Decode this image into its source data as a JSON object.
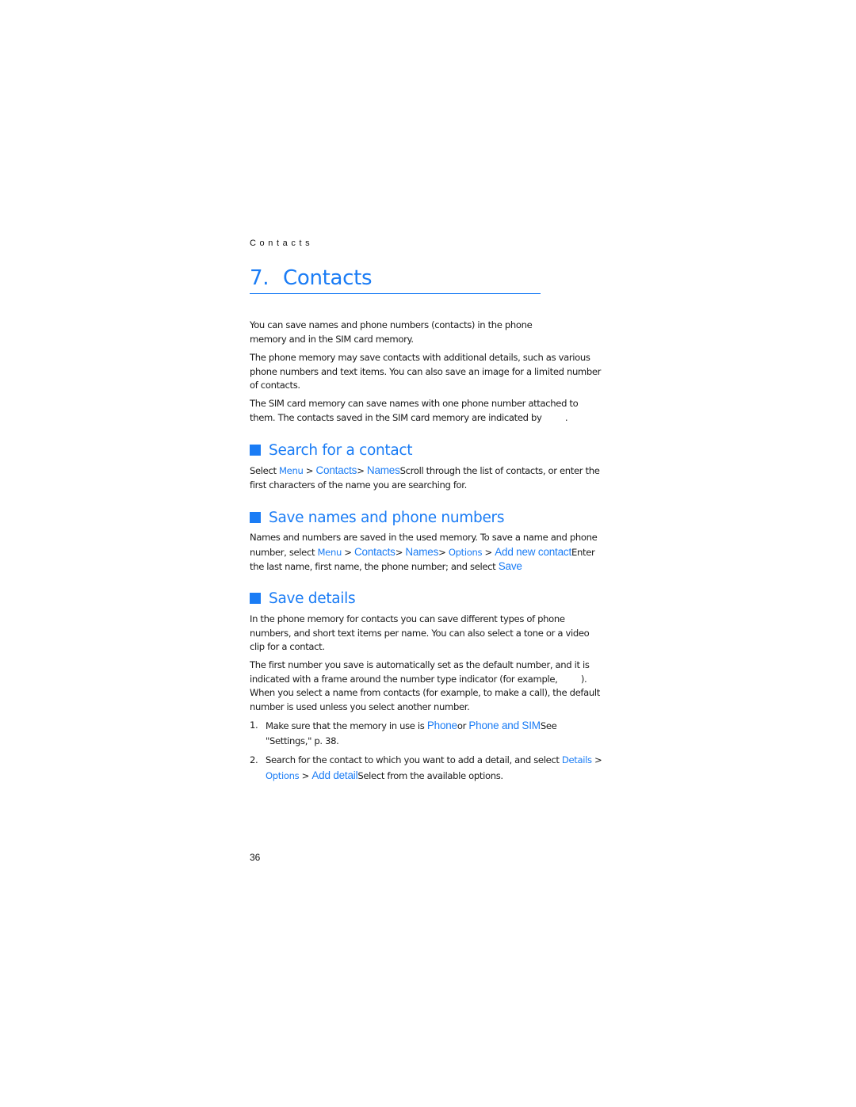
{
  "running_head": "Contacts",
  "chapter": {
    "number": "7.",
    "title": "Contacts"
  },
  "intro": {
    "p1": "You can save names and phone numbers (contacts) in the phone memory and in the SIM card memory.",
    "p1_line1": "You can save names and phone numbers (contacts) in the phone",
    "p1_line2": "memory and in the SIM card memory.",
    "p2": "The phone memory may save contacts with additional details, such as various phone numbers and text items. You can also save an image for a limited number of contacts.",
    "p3_a": "The SIM card memory can save names with one phone number attached to them. The contacts saved in the SIM card memory are indicated by",
    "p3_icon": "sim-contact-icon",
    "p3_b": "."
  },
  "sections": {
    "search": {
      "title": "Search for a contact",
      "t1": "Select ",
      "menu": "Menu",
      "sep1": " > ",
      "contacts": "Contacts",
      "sep2": "> ",
      "names": "Names",
      "t2": "Scroll through the list of contacts, or enter the first characters of the name you are searching for."
    },
    "save_names": {
      "title": "Save names and phone numbers",
      "t1": "Names and numbers are saved in the used memory. To save a name and phone number, select ",
      "menu": "Menu",
      "sep1": " > ",
      "contacts": "Contacts",
      "sep2": "> ",
      "names": "Names",
      "sep3": "> ",
      "options": "Options",
      "sep4": " > ",
      "add_new": "Add new contact",
      "t2": "Enter the last name, first name, the phone number; and select ",
      "save": "Save"
    },
    "save_details": {
      "title": "Save details",
      "p1": "In the phone memory for contacts you can save different types of phone numbers, and short text items per name. You can also select a tone or a video clip for a contact.",
      "p2_a": "The first number you save is automatically set as the default number, and it is indicated with a frame around the number type indicator (for example,",
      "p2_icon": "default-number-indicator-icon",
      "p2_b": "). When you select a name from contacts (for example, to make a call), the default number is used unless you select another number.",
      "steps": [
        {
          "n": "1.",
          "t1": "Make sure that the memory in use is ",
          "k1": "Phone",
          "t2": "or ",
          "k2": "Phone and SIM",
          "t3": "See \"Settings,\" p. 38."
        },
        {
          "n": "2.",
          "t1": "Search for the contact to which you want to add a detail, and select ",
          "k1": "Details",
          "t2": " > ",
          "k2": "Options",
          "t3": " > ",
          "k3": "Add detail",
          "t4": "Select from the available options."
        }
      ]
    }
  },
  "page_number": "36",
  "colors": {
    "accent": "#1a7cf5",
    "text": "#1a1a1a"
  }
}
